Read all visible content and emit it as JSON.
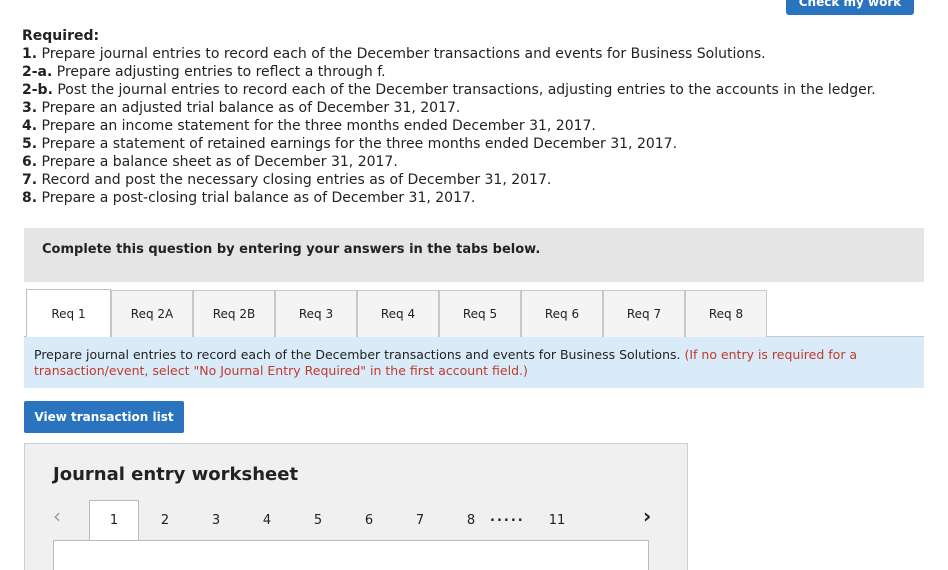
{
  "header": {
    "check_label": "Check my work"
  },
  "required": {
    "heading": "Required:",
    "items": [
      {
        "num": "1.",
        "text": " Prepare journal entries to record each of the December transactions and events for Business Solutions."
      },
      {
        "num": "2-a.",
        "text": " Prepare adjusting entries to reflect a through f."
      },
      {
        "num": "2-b.",
        "text": " Post the journal entries to record each of the December transactions, adjusting entries to the accounts in the ledger."
      },
      {
        "num": "3.",
        "text": " Prepare an adjusted trial balance as of December 31, 2017."
      },
      {
        "num": "4.",
        "text": " Prepare an income statement for the three months ended December 31, 2017."
      },
      {
        "num": "5.",
        "text": " Prepare a statement of retained earnings for the three months ended December 31, 2017."
      },
      {
        "num": "6.",
        "text": " Prepare a balance sheet as of December 31, 2017."
      },
      {
        "num": "7.",
        "text": " Record and post the necessary closing entries as of December 31, 2017."
      },
      {
        "num": "8.",
        "text": " Prepare a post-closing trial balance as of December 31, 2017."
      }
    ]
  },
  "instruction": "Complete this question by entering your answers in the tabs below.",
  "tabs": [
    "Req 1",
    "Req 2A",
    "Req 2B",
    "Req 3",
    "Req 4",
    "Req 5",
    "Req 6",
    "Req 7",
    "Req 8"
  ],
  "prompt": {
    "text": "Prepare journal entries to record each of the December transactions and events for Business Solutions. ",
    "note": "(If no entry is required for a transaction/event, select \"No Journal Entry Required\" in the first account field.)"
  },
  "view_button": "View transaction list",
  "worksheet": {
    "title": "Journal entry worksheet",
    "pages": [
      "1",
      "2",
      "3",
      "4",
      "5",
      "6",
      "7",
      "8"
    ],
    "ellipsis": ".....",
    "last_page": "11"
  }
}
